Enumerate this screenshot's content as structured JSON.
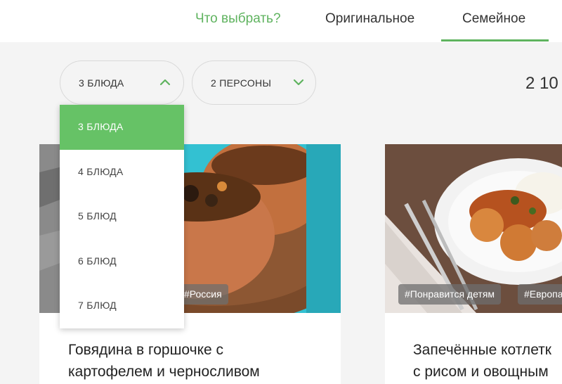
{
  "nav": {
    "what_to_choose": "Что выбрать?",
    "original": "Оригинальное",
    "family": "Семейное"
  },
  "filters": {
    "dishes_selected": "3 БЛЮДА",
    "persons_selected": "2 ПЕРСОНЫ",
    "dishes_options": [
      "3 БЛЮДА",
      "4 БЛЮДА",
      "5 БЛЮД",
      "6 БЛЮД",
      "7 БЛЮД"
    ]
  },
  "price_partial": "2 10",
  "cards": [
    {
      "tag_visible": "#Россия",
      "title_line1": "Говядина в горшочке с",
      "title_line2": "картофелем и черносливом"
    },
    {
      "tags": [
        "#Понравится детям",
        "#Европа"
      ],
      "title_line1": "Запечённые котлетк",
      "title_line2": "с рисом и овощным"
    }
  ],
  "colors": {
    "accent": "#5fb35f",
    "active_option": "#66c266"
  }
}
